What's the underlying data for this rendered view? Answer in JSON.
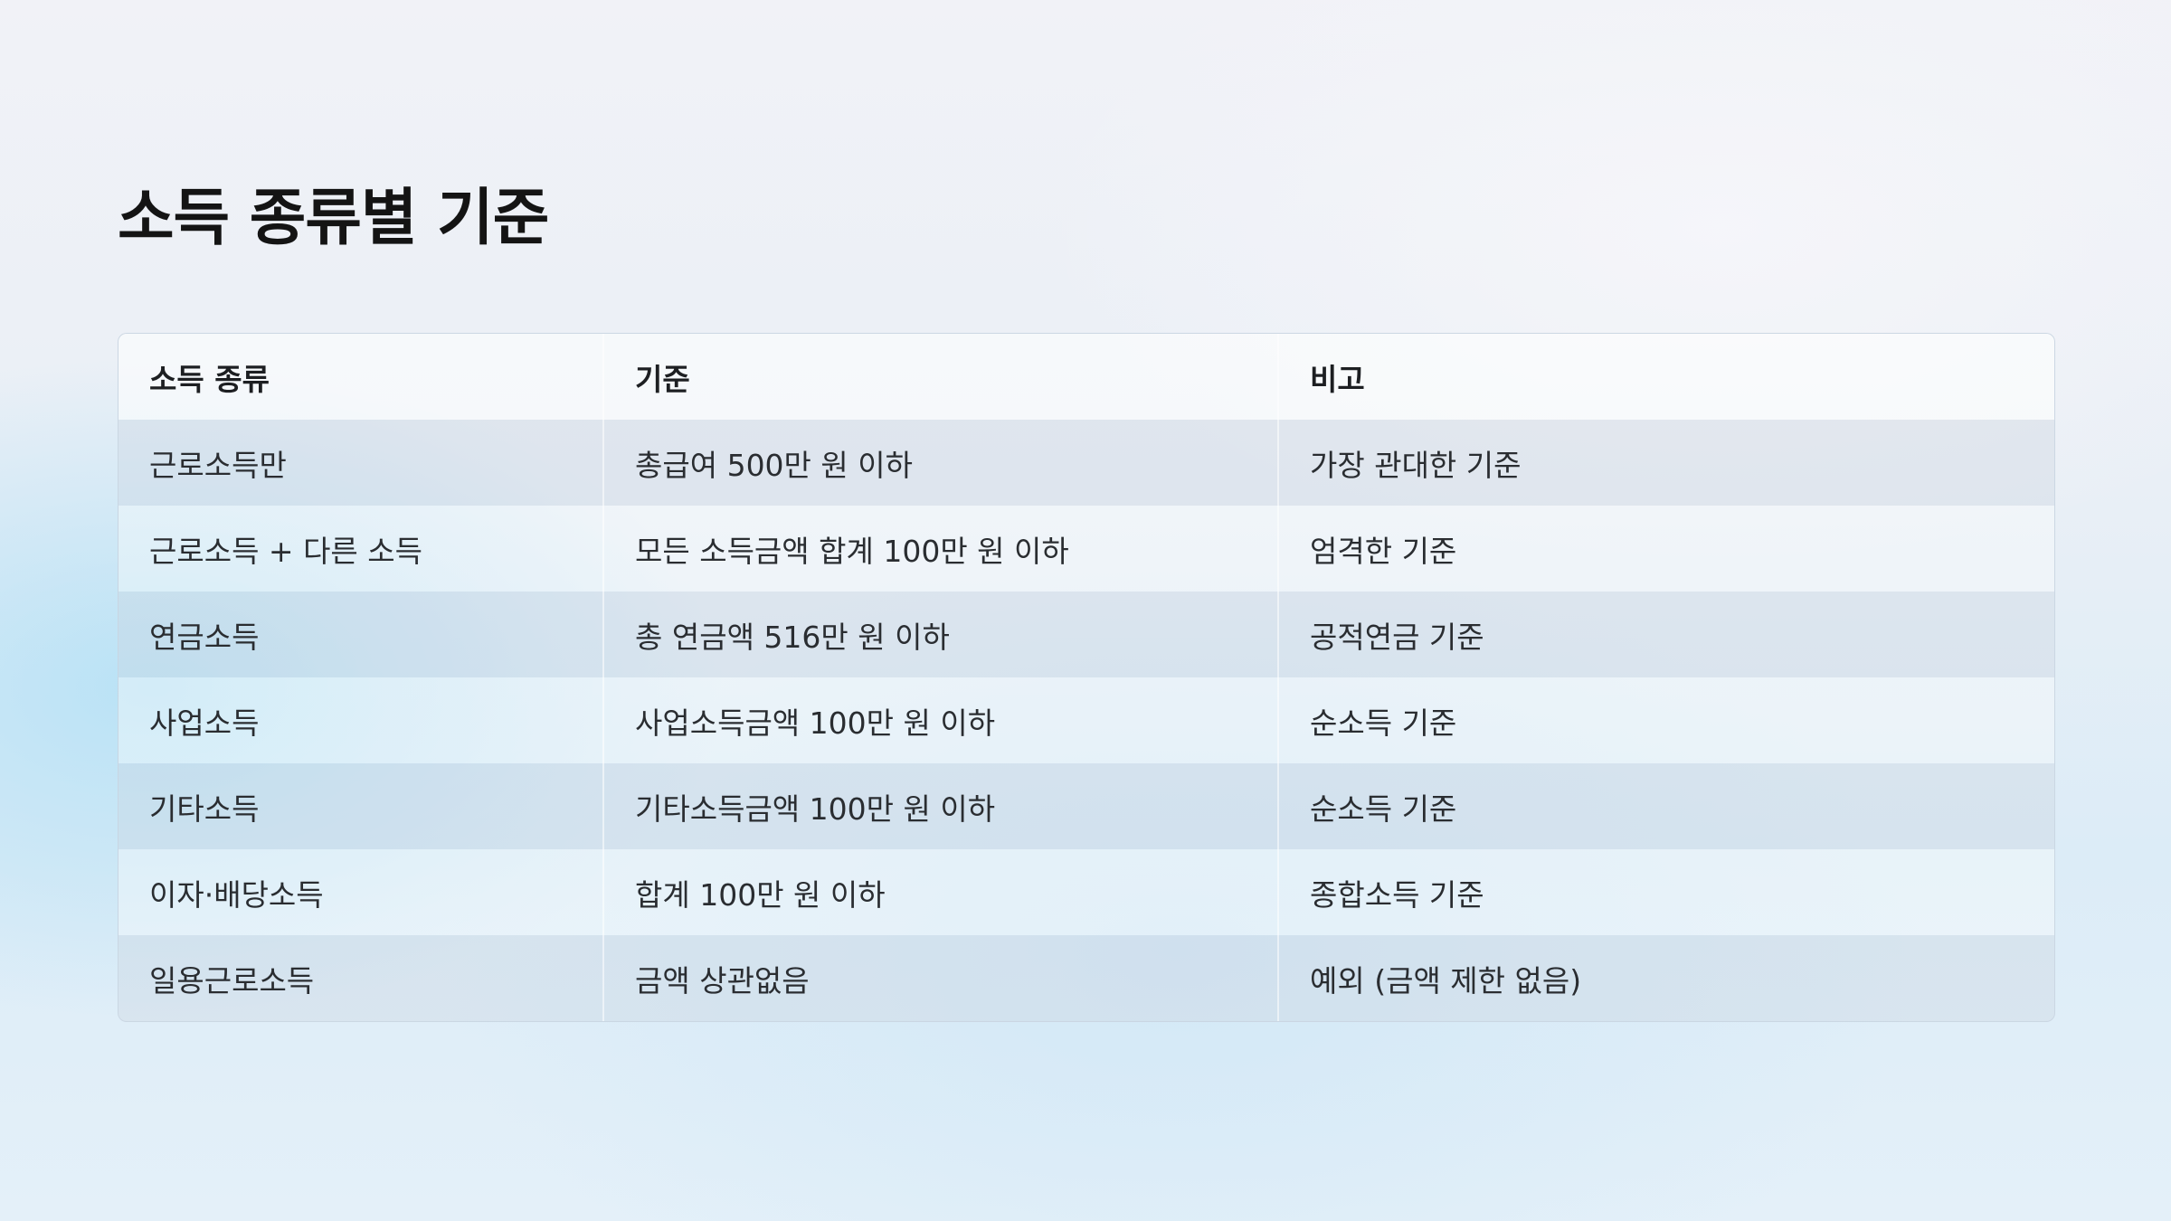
{
  "page": {
    "title": "소득 종류별 기준"
  },
  "table": {
    "headers": [
      "소득 종류",
      "기준",
      "비고"
    ],
    "rows": [
      [
        "근로소득만",
        "총급여 500만 원 이하",
        "가장 관대한 기준"
      ],
      [
        "근로소득 + 다른 소득",
        "모든 소득금액 합계 100만 원 이하",
        "엄격한 기준"
      ],
      [
        "연금소득",
        "총 연금액 516만 원 이하",
        "공적연금 기준"
      ],
      [
        "사업소득",
        "사업소득금액 100만 원 이하",
        "순소득 기준"
      ],
      [
        "기타소득",
        "기타소득금액 100만 원 이하",
        "순소득 기준"
      ],
      [
        "이자·배당소득",
        "합계 100만 원 이하",
        "종합소득 기준"
      ],
      [
        "일용근로소득",
        "금액 상관없음",
        "예외 (금액 제한 없음)"
      ]
    ]
  },
  "colors": {
    "title": "#141414",
    "text": "#2a2d31",
    "accent_background": "#c4e6f6"
  }
}
